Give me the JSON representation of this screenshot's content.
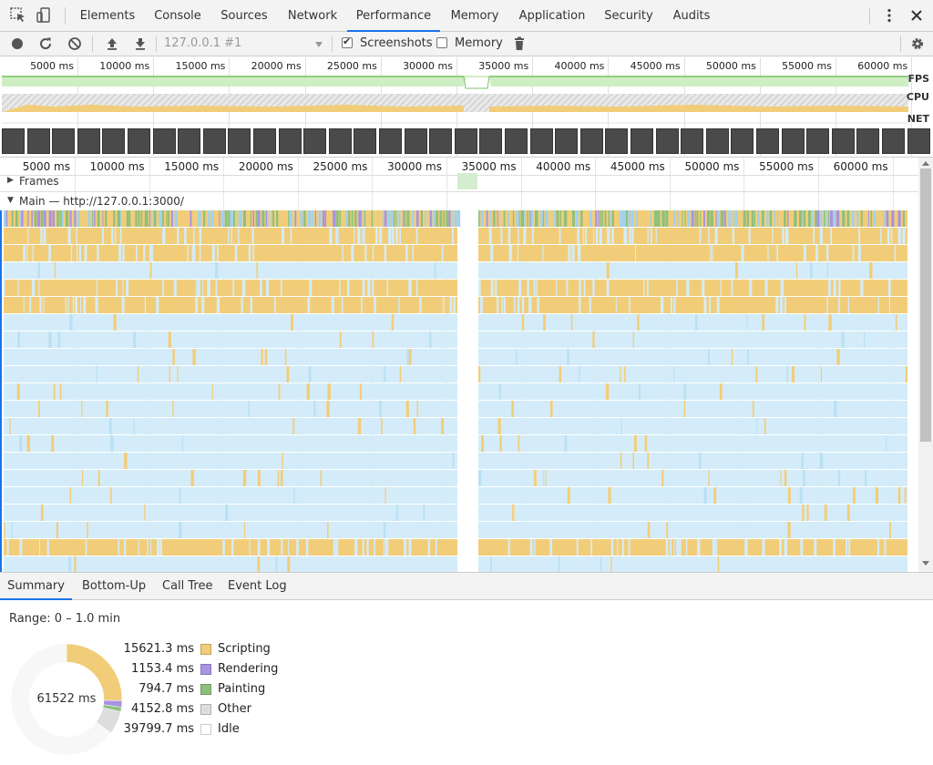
{
  "tabs": [
    "Elements",
    "Console",
    "Sources",
    "Network",
    "Performance",
    "Memory",
    "Application",
    "Security",
    "Audits"
  ],
  "active_tab": "Performance",
  "toolbar": {
    "url_select": "127.0.0.1 #1",
    "screenshots_label": "Screenshots",
    "screenshots_checked": true,
    "memory_label": "Memory",
    "memory_checked": false
  },
  "overview": {
    "time_labels": [
      "5000 ms",
      "10000 ms",
      "15000 ms",
      "20000 ms",
      "25000 ms",
      "30000 ms",
      "35000 ms",
      "40000 ms",
      "45000 ms",
      "50000 ms",
      "55000 ms",
      "60000 ms"
    ],
    "fps_label": "FPS",
    "cpu_label": "CPU",
    "net_label": "NET"
  },
  "flame": {
    "time_labels": [
      "5000 ms",
      "10000 ms",
      "15000 ms",
      "20000 ms",
      "25000 ms",
      "30000 ms",
      "35000 ms",
      "40000 ms",
      "45000 ms",
      "50000 ms",
      "55000 ms",
      "60000 ms"
    ],
    "frames_label": "Frames",
    "main_label": "Main — http://127.0.0.1:3000/"
  },
  "bottom_tabs": [
    "Summary",
    "Bottom-Up",
    "Call Tree",
    "Event Log"
  ],
  "active_bottom_tab": "Summary",
  "summary": {
    "range": "Range: 0 – 1.0 min",
    "total": "61522 ms",
    "items": [
      {
        "value": "15621.3 ms",
        "name": "Scripting",
        "color": "#f2cd79"
      },
      {
        "value": "1153.4 ms",
        "name": "Rendering",
        "color": "#a993e4"
      },
      {
        "value": "794.7 ms",
        "name": "Painting",
        "color": "#8ec07c"
      },
      {
        "value": "4152.8 ms",
        "name": "Other",
        "color": "#dddddd"
      },
      {
        "value": "39799.7 ms",
        "name": "Idle",
        "color": "#ffffff"
      }
    ],
    "donut_values_ms": [
      15621.3,
      1153.4,
      794.7,
      4152.8,
      39799.7
    ]
  },
  "colors": {
    "accent": "#1a73e8",
    "scripting": "#f2cd79",
    "rendering": "#a993e4",
    "painting": "#8ec07c",
    "idle_task": "#d4ecf9"
  }
}
